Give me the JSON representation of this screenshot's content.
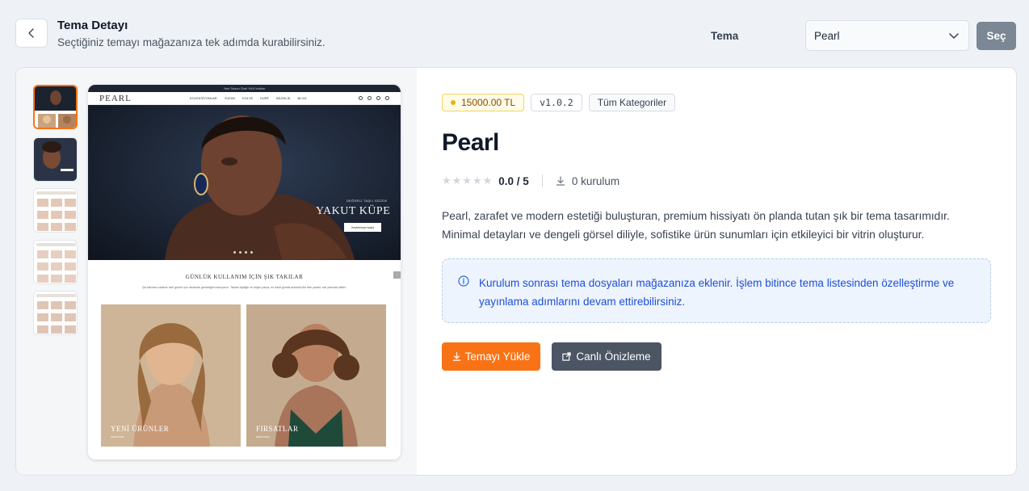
{
  "header": {
    "title": "Tema Detayı",
    "subtitle": "Seçtiğiniz temayı mağazanıza tek adımda kurabilirsiniz.",
    "theme_label": "Tema",
    "theme_select_value": "Pearl",
    "select_button": "Seç"
  },
  "gallery": {
    "thumbnails": [
      "thumb-1",
      "thumb-2",
      "thumb-3",
      "thumb-4",
      "thumb-5"
    ],
    "active_index": 0
  },
  "preview": {
    "topbar_text": "Yeni Sezon Özel %10 İndirim",
    "logo": "PEARL",
    "menu": [
      "KOLEKSİYONLAR",
      "YÜZÜK",
      "KOLYE",
      "KÜPE",
      "BİLEKLİK",
      "BLOG"
    ],
    "hero_tag": "DEĞERLİ TAŞLI GÖZDE",
    "hero_title": "YAKUT KÜPE",
    "hero_button": "Keşfetmeye başla",
    "section_title": "GÜNLÜK KULLANIM İÇİN ŞIK TAKILAR",
    "section_desc": "Şık takıların sadece özel günler için olmamalı gerektiğini inanıyoruz. Takılar kişiliğin ve doğru parça, en basit günlük anlarda bile fark yaratır, sizi yansıtan stiller.",
    "card1_label": "YENİ ÜRÜNLER",
    "card1_sub": "SHOP NOW",
    "card2_label": "FIRSATLAR",
    "card2_sub": "SHOP NOW"
  },
  "theme": {
    "price": "15000.00 TL",
    "version": "v1.0.2",
    "category": "Tüm Kategoriler",
    "name": "Pearl",
    "stars": "★★★★★",
    "rating": "0.0 / 5",
    "installs": "0 kurulum",
    "description": "Pearl, zarafet ve modern estetiği buluşturan, premium hissiyatı ön planda tutan şık bir tema tasarımıdır. Minimal detayları ve dengeli görsel diliyle, sofistike ürün sunumları için etkileyici bir vitrin oluşturur.",
    "info": "Kurulum sonrası tema dosyaları mağazanıza eklenir. İşlem bitince tema listesinden özelleştirme ve yayınlama adımlarını devam ettirebilirsiniz.",
    "install_button": "Temayı Yükle",
    "preview_button": "Canlı Önizleme"
  },
  "colors": {
    "accent": "#f97316",
    "secondary_button": "#4b5563",
    "info_text": "#1d4ed8"
  }
}
